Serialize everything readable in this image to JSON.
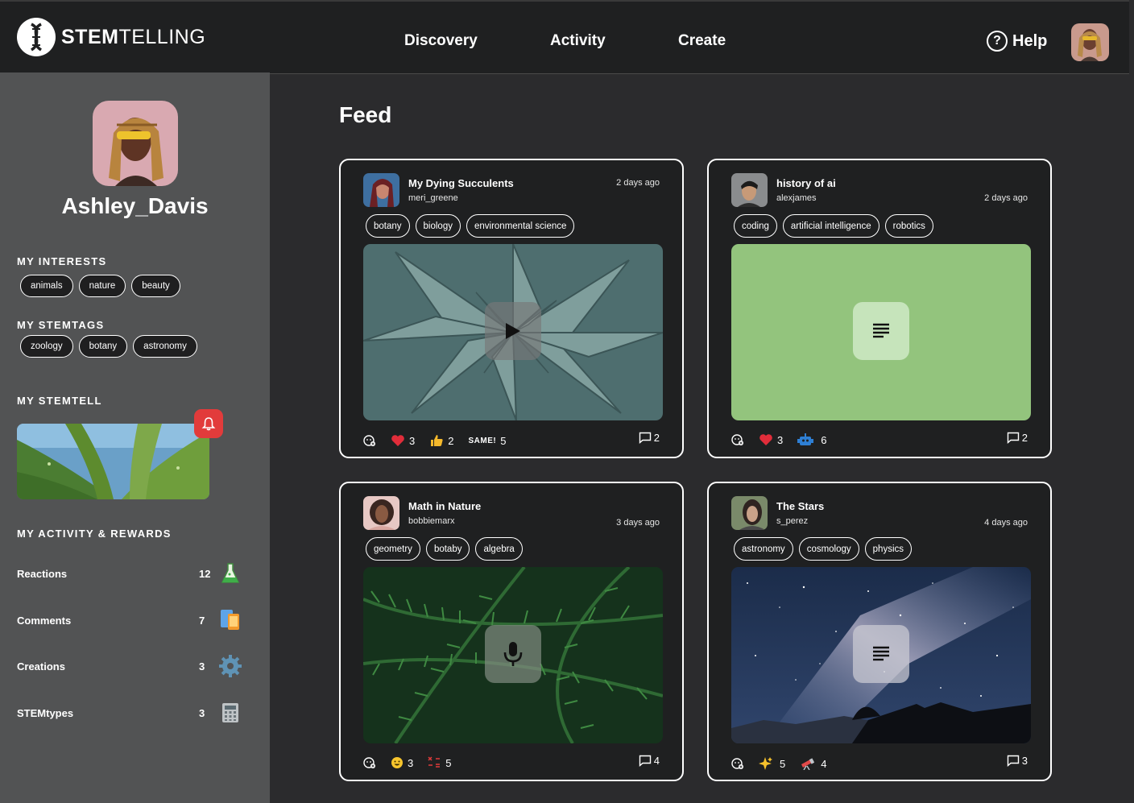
{
  "header": {
    "brand_bold": "STEM",
    "brand_light": "TELLING",
    "nav": [
      "Discovery",
      "Activity",
      "Create"
    ],
    "help": "Help"
  },
  "sidebar": {
    "username": "Ashley_Davis",
    "interests_title": "MY INTERESTS",
    "interests": [
      "animals",
      "nature",
      "beauty"
    ],
    "stemtags_title": "MY STEMTAGS",
    "stemtags": [
      "zoology",
      "botany",
      "astronomy"
    ],
    "stemtell_title": "MY STEMTELL",
    "activity_title": "MY ACTIVITY & REWARDS",
    "activity": [
      {
        "label": "Reactions",
        "count": "12",
        "icon": "flask-icon"
      },
      {
        "label": "Comments",
        "count": "7",
        "icon": "devices-icon"
      },
      {
        "label": "Creations",
        "count": "3",
        "icon": "gear-icon"
      },
      {
        "label": "STEMtypes",
        "count": "3",
        "icon": "calculator-icon"
      }
    ]
  },
  "feed": {
    "title": "Feed",
    "cards": [
      {
        "title": "My Dying Succulents",
        "author": "meri_greene",
        "time": "2 days ago",
        "tags": [
          "botany",
          "biology",
          "environmental science"
        ],
        "media": "video",
        "reactions": [
          {
            "icon": "heart-icon",
            "count": "3"
          },
          {
            "icon": "thumbs-up-icon",
            "count": "2"
          },
          {
            "icon": "same-icon",
            "label": "SAME!",
            "count": "5"
          }
        ],
        "comments": "2"
      },
      {
        "title": "history of ai",
        "author": "alexjames",
        "time": "2 days ago",
        "tags": [
          "coding",
          "artificial intelligence",
          "robotics"
        ],
        "media": "text",
        "reactions": [
          {
            "icon": "heart-icon",
            "count": "3"
          },
          {
            "icon": "robot-icon",
            "count": "6"
          }
        ],
        "comments": "2"
      },
      {
        "title": "Math in Nature",
        "author": "bobbiemarx",
        "time": "3 days ago",
        "tags": [
          "geometry",
          "botaby",
          "algebra"
        ],
        "media": "audio",
        "reactions": [
          {
            "icon": "smile-icon",
            "count": "3"
          },
          {
            "icon": "math-symbols-icon",
            "count": "5"
          }
        ],
        "comments": "4"
      },
      {
        "title": "The Stars",
        "author": "s_perez",
        "time": "4 days ago",
        "tags": [
          "astronomy",
          "cosmology",
          "physics"
        ],
        "media": "text",
        "reactions": [
          {
            "icon": "sparkles-icon",
            "count": "5"
          },
          {
            "icon": "telescope-icon",
            "count": "4"
          }
        ],
        "comments": "3"
      }
    ]
  },
  "colors": {
    "sidebar_bg": "#525354",
    "main_bg": "#2b2b2d",
    "card_bg": "#1f2021",
    "text_card_green": "#93c47d",
    "bell_red": "#e23b3b"
  }
}
